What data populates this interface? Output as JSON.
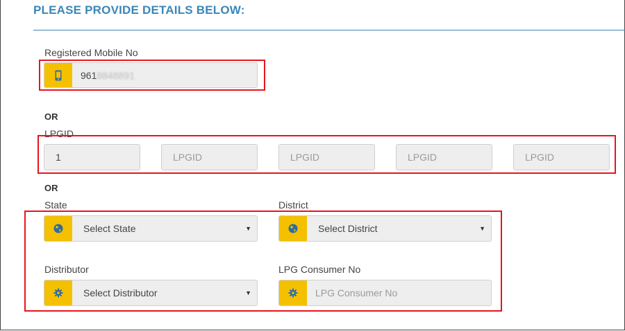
{
  "heading": "PLEASE PROVIDE DETAILS BELOW:",
  "mobile": {
    "label": "Registered Mobile No",
    "value_visible": "961",
    "value_masked": "8848891",
    "icon": "mobile-phone-icon"
  },
  "or1": "OR",
  "lpgid": {
    "label": "LPGID",
    "first_value": "1",
    "placeholder": "LPGID"
  },
  "or2": "OR",
  "state": {
    "label": "State",
    "selected": "Select State",
    "icon": "globe-icon"
  },
  "district": {
    "label": "District",
    "selected": "Select District",
    "icon": "globe-icon"
  },
  "distributor": {
    "label": "Distributor",
    "selected": "Select Distributor",
    "icon": "gear-icon"
  },
  "consumer": {
    "label": "LPG Consumer No",
    "placeholder": "LPG Consumer No",
    "icon": "gear-icon"
  },
  "colors": {
    "accent": "#3a86b8",
    "icon_bg": "#f5c000",
    "highlight": "#e8141c",
    "field_bg": "#eeeeee"
  }
}
